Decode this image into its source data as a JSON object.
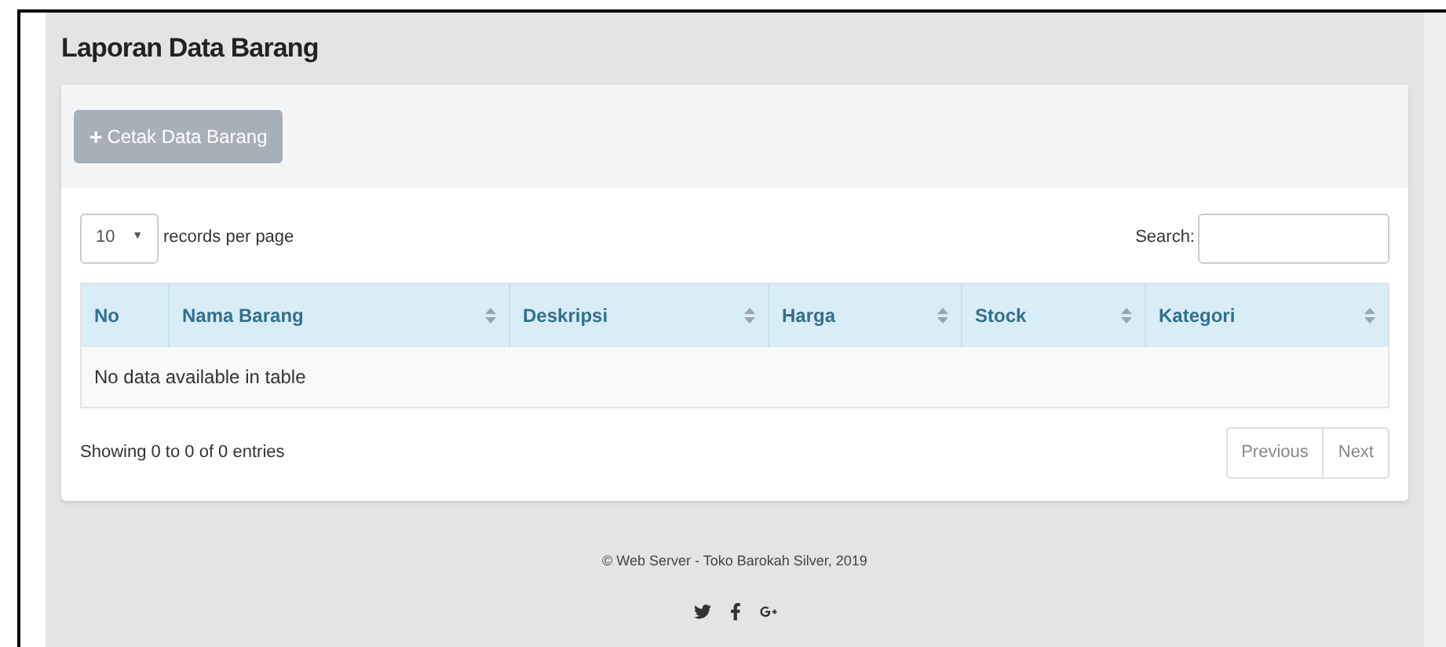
{
  "page_title": "Laporan Data Barang",
  "print_button": {
    "icon": "+",
    "label": "Cetak Data Barang"
  },
  "length_select": {
    "value": "10",
    "caret": "▼",
    "label": "records per page"
  },
  "search": {
    "label": "Search:"
  },
  "table": {
    "columns": [
      {
        "label": "No",
        "sortable": false
      },
      {
        "label": "Nama Barang",
        "sortable": true
      },
      {
        "label": "Deskripsi",
        "sortable": true
      },
      {
        "label": "Harga",
        "sortable": true
      },
      {
        "label": "Stock",
        "sortable": true
      },
      {
        "label": "Kategori",
        "sortable": true
      }
    ],
    "empty_message": "No data available in table"
  },
  "info": "Showing 0 to 0 of 0 entries",
  "pagination": [
    {
      "label": "Previous",
      "disabled": true
    },
    {
      "label": "Next",
      "disabled": true
    }
  ],
  "footer": {
    "copyright": "© Web Server - Toko Barokah Silver, 2019",
    "social": [
      {
        "kind": "twitter"
      },
      {
        "kind": "facebook"
      },
      {
        "kind": "googleplus"
      }
    ]
  }
}
